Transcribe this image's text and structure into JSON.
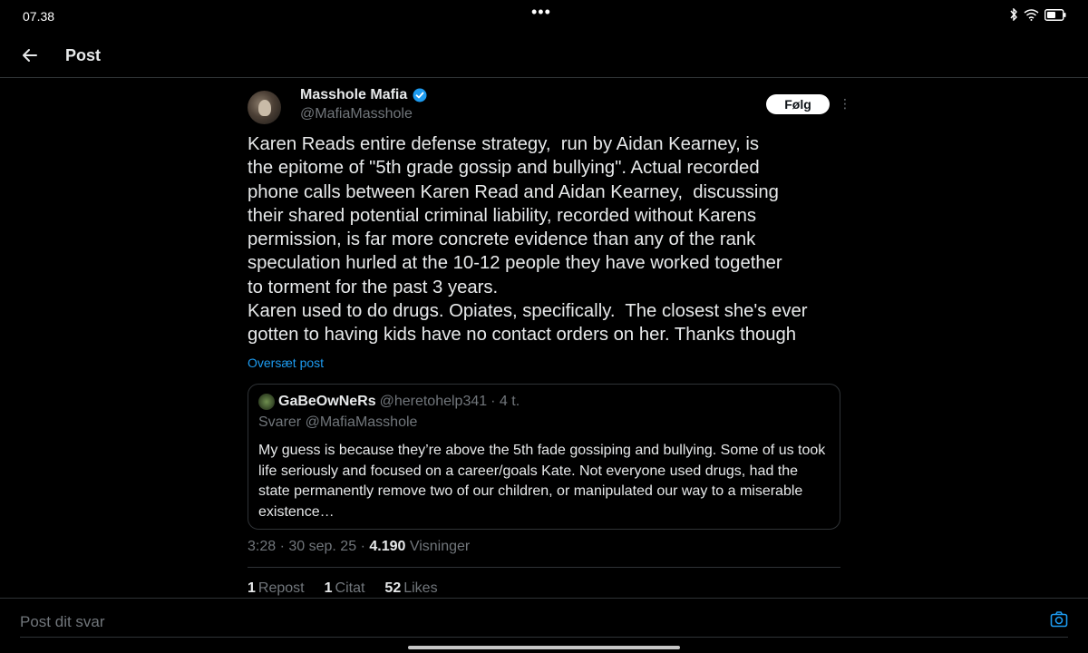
{
  "statusbar": {
    "time": "07.38",
    "dots": "•••"
  },
  "header": {
    "title": "Post"
  },
  "post": {
    "author_name": "Masshole Mafia",
    "author_handle": "@MafiaMasshole",
    "follow_label": "Følg",
    "more_label": "⋮",
    "text": "Karen Reads entire defense strategy,  run by Aidan Kearney, is\nthe epitome of \"5th grade gossip and bullying\". Actual recorded\nphone calls between Karen Read and Aidan Kearney,  discussing\ntheir shared potential criminal liability, recorded without Karens\npermission, is far more concrete evidence than any of the rank\nspeculation hurled at the 10-12 people they have worked together\nto torment for the past 3 years.\nKaren used to do drugs. Opiates, specifically.  The closest she's ever\ngotten to having kids have no contact orders on her. Thanks though",
    "translate_label": "Oversæt post",
    "time": "3:28",
    "date": "30 sep. 25",
    "views_count": "4.190",
    "views_label": "Visninger",
    "meta_sep": "·"
  },
  "quote": {
    "name": "GaBeOwNeRs",
    "handle": "@heretohelp341",
    "age": "· 4 t.",
    "reply_to": "Svarer @MafiaMasshole",
    "text": "My guess is because they’re above the 5th fade gossiping and bullying. Some of us took life seriously and focused on a career/goals Kate. Not everyone used drugs, had the state permanently remove two of our children, or manipulated our way to a miserable existence…"
  },
  "stats": [
    {
      "count": "1",
      "label": "Repost"
    },
    {
      "count": "1",
      "label": "Citat"
    },
    {
      "count": "52",
      "label": "Likes"
    }
  ],
  "reply": {
    "placeholder": "Post dit svar"
  },
  "colors": {
    "accent": "#1d9bf0",
    "background": "#000000",
    "muted": "#71767b",
    "text": "#e7e9ea"
  }
}
